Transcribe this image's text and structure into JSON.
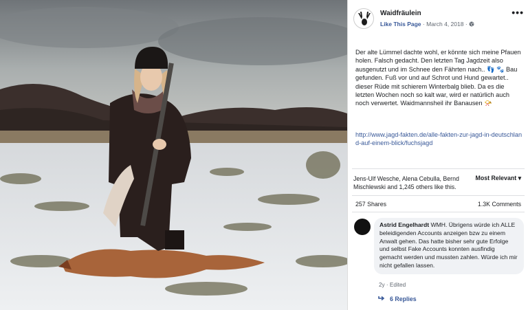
{
  "post": {
    "page_name": "Waidfräulein",
    "like_label": "Like This Page",
    "separator": "·",
    "date": "March 4, 2018",
    "separator2": "·",
    "privacy_icon": "globe-icon",
    "more_label": "•••",
    "text": "Der alte Lümmel dachte wohl, er könnte sich meine Pfauen holen. Falsch gedacht. Den letzten Tag Jagdzeit also ausgenutzt und im Schnee den Fährten nach.. 👣 🐾 Bau gefunden. Fuß vor und auf Schrot und Hund gewartet.. dieser Rüde mit schierem Winterbalg blieb. Da es die letzten Wochen noch so kalt war, wird er natürlich auch noch verwertet. Waidmannsheil ihr Banausen 📯",
    "link": "http://www.jagd-fakten.de/alle-fakten-zur-jagd-in-deutschland-auf-einem-blick/fuchsjagd"
  },
  "reactions": {
    "likes_text": "Jens-Ulf Wesche, Alena Cebulla, Bernd Mischlewski and 1,245 others like this.",
    "sort_label": "Most Relevant ▾",
    "shares": "257 Shares",
    "comments": "1.3K Comments"
  },
  "comment": {
    "author": "Astrid Engelhardt",
    "text": "WMH. Übrigens würde ich ALLE beleidigenden Accounts anzeigen bzw zu einem Anwalt gehen. Das hatte bisher sehr gute Erfolge und selbst Fake Accounts konnten ausfindig gemacht werden und mussten zahlen. Würde ich mir nicht gefallen lassen.",
    "meta": "2y · Edited",
    "replies": "6 Replies",
    "replies_icon": "reply-arrow-icon"
  },
  "colors": {
    "link": "#385898",
    "bubble": "#f0f2f5",
    "muted": "#606770"
  }
}
